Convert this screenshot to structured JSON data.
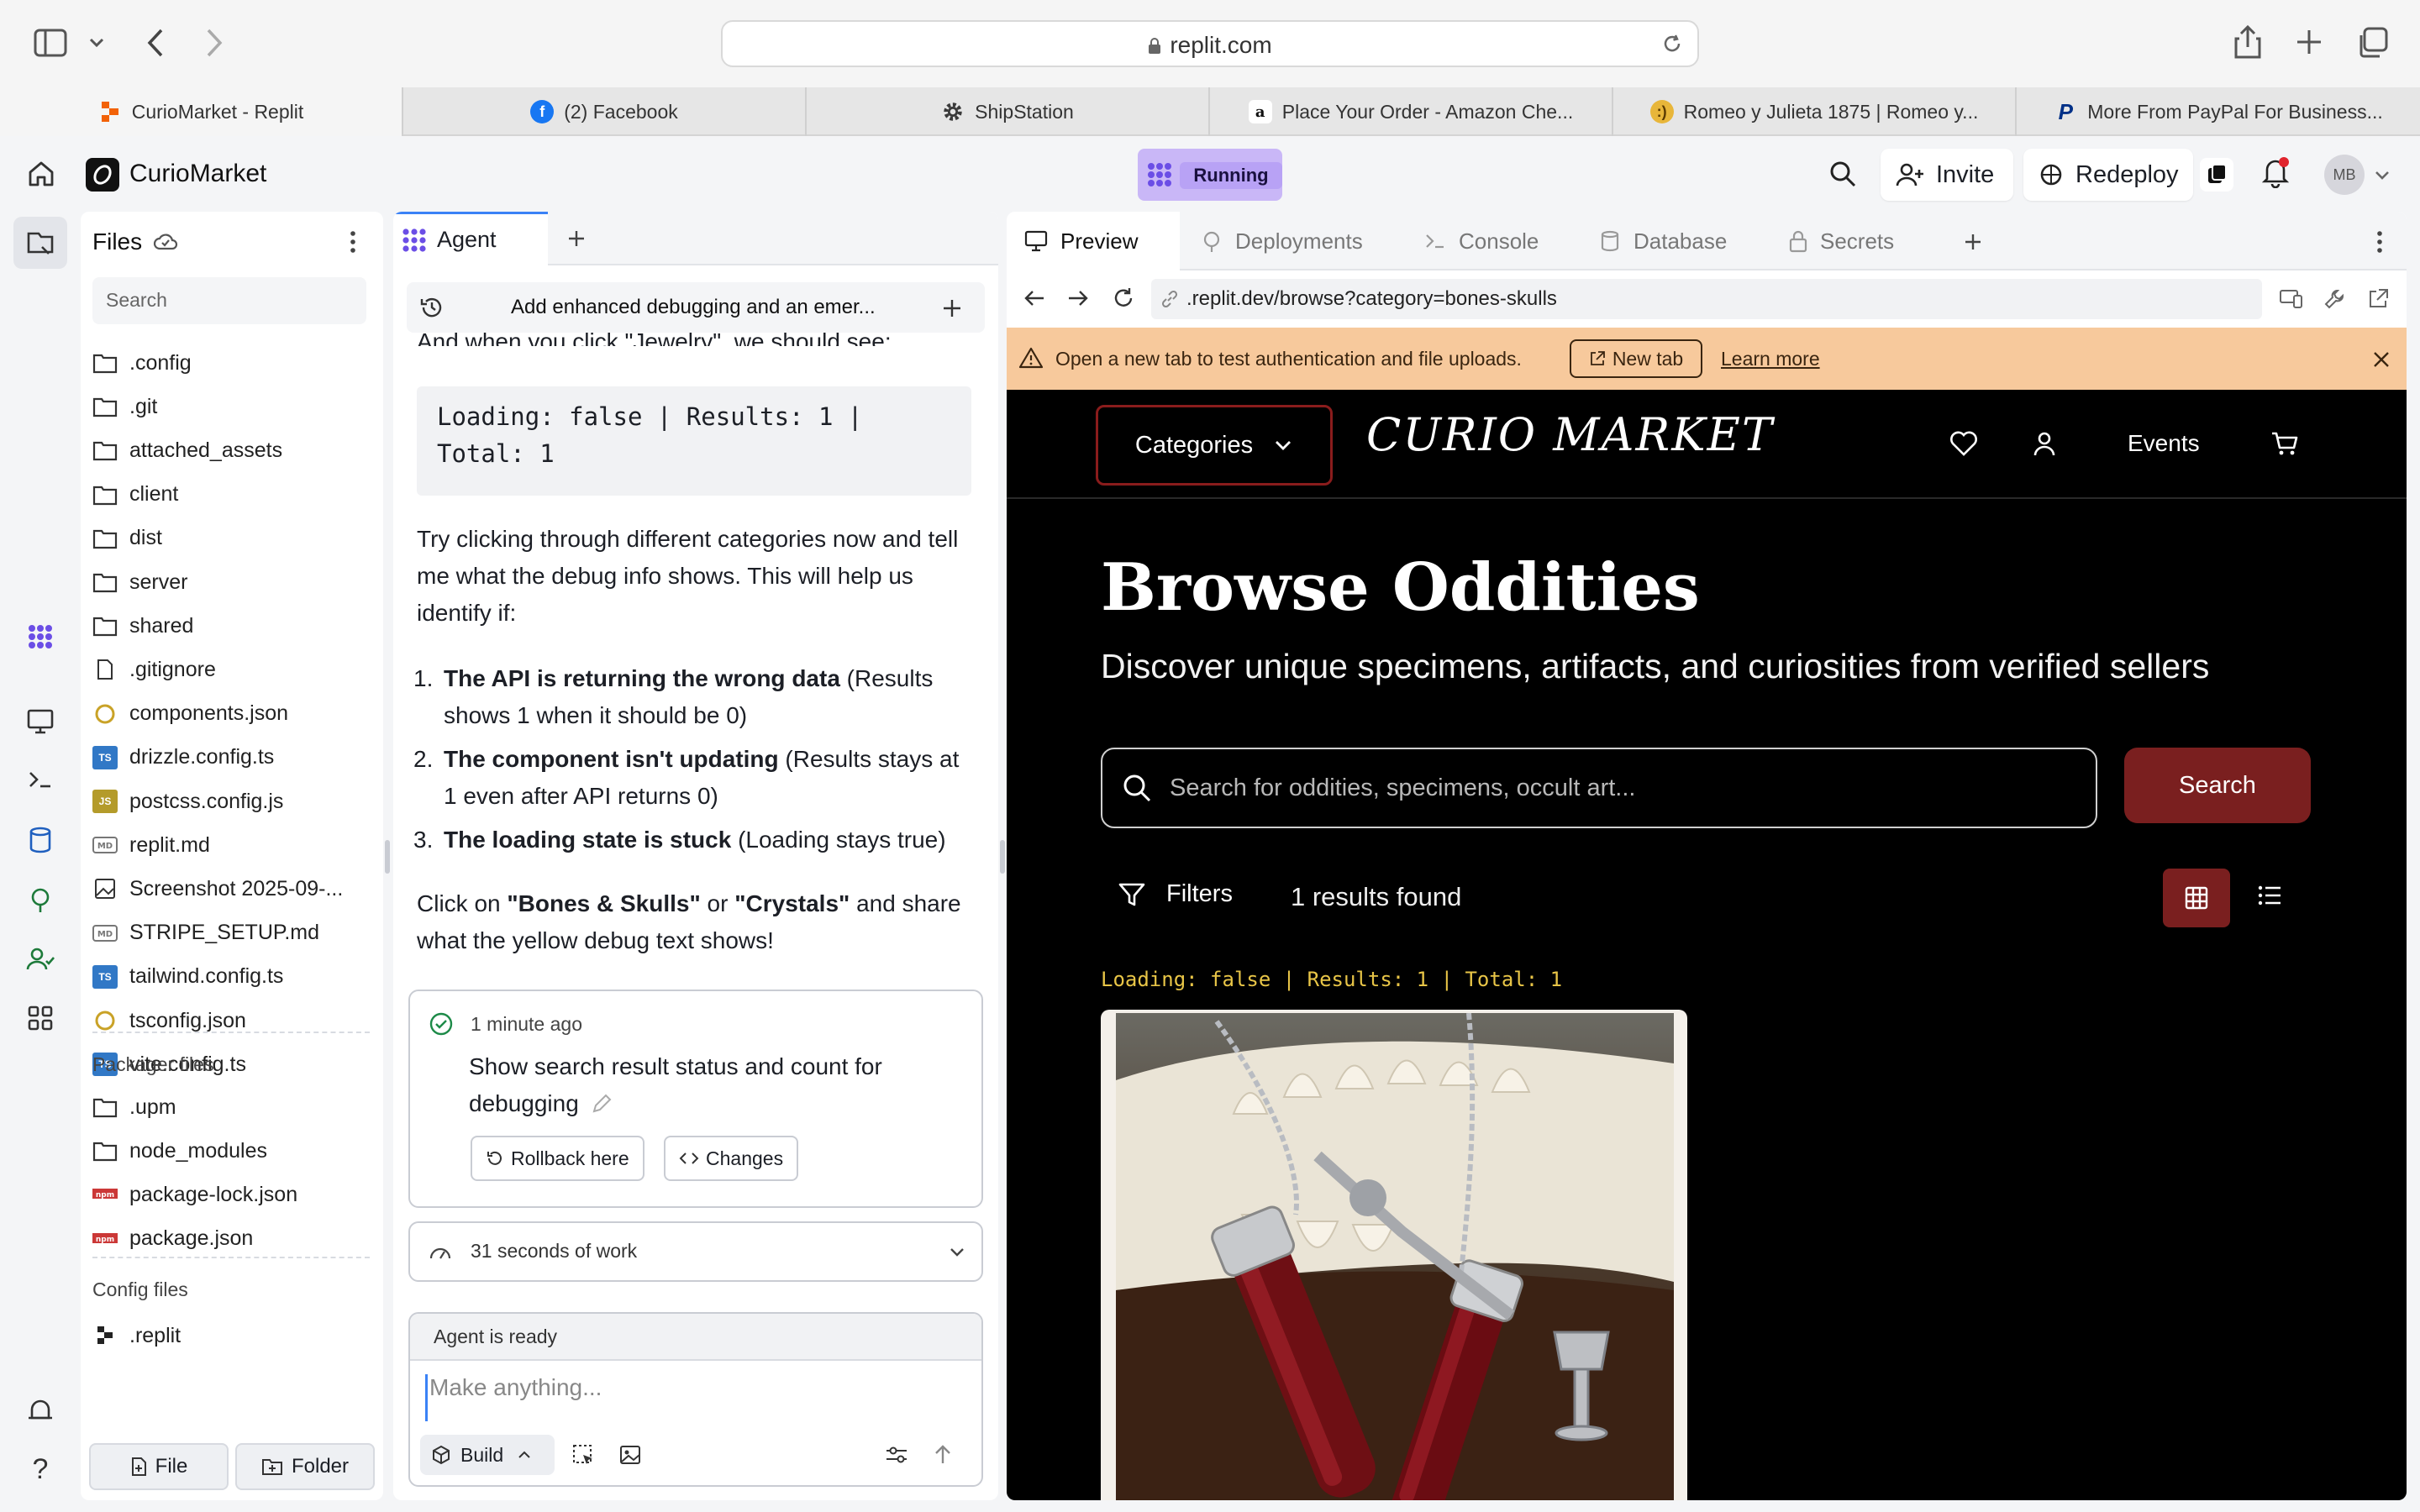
{
  "browser": {
    "url": "replit.com",
    "tabs": [
      {
        "label": "CurioMarket - Replit",
        "icon": "replit-icon",
        "color": "#f26207"
      },
      {
        "label": "(2) Facebook",
        "icon": "facebook-icon",
        "color": "#1877f2"
      },
      {
        "label": "ShipStation",
        "icon": "gear-icon",
        "color": "#4a4a4a"
      },
      {
        "label": "Place Your Order - Amazon Che...",
        "icon": "amazon-icon",
        "color": "#111111"
      },
      {
        "label": "Romeo y Julieta 1875 | Romeo y...",
        "icon": "emoji-icon",
        "color": "#e8b63a"
      },
      {
        "label": "More From PayPal For Business...",
        "icon": "paypal-icon",
        "color": "#003087"
      }
    ]
  },
  "header": {
    "project": "CurioMarket",
    "status": "Running",
    "invite": "Invite",
    "redeploy": "Redeploy",
    "avatar": "MB"
  },
  "files": {
    "title": "Files",
    "search_placeholder": "Search",
    "items": [
      {
        "name": ".config",
        "type": "folder"
      },
      {
        "name": ".git",
        "type": "folder"
      },
      {
        "name": "attached_assets",
        "type": "folder"
      },
      {
        "name": "client",
        "type": "folder"
      },
      {
        "name": "dist",
        "type": "folder"
      },
      {
        "name": "server",
        "type": "folder"
      },
      {
        "name": "shared",
        "type": "folder"
      },
      {
        "name": ".gitignore",
        "type": "file"
      },
      {
        "name": "components.json",
        "type": "json"
      },
      {
        "name": "drizzle.config.ts",
        "type": "ts"
      },
      {
        "name": "postcss.config.js",
        "type": "js"
      },
      {
        "name": "replit.md",
        "type": "md"
      },
      {
        "name": "Screenshot 2025-09-...",
        "type": "image"
      },
      {
        "name": "STRIPE_SETUP.md",
        "type": "md"
      },
      {
        "name": "tailwind.config.ts",
        "type": "ts"
      },
      {
        "name": "tsconfig.json",
        "type": "json"
      },
      {
        "name": "vite.config.ts",
        "type": "ts"
      }
    ],
    "packager_title": "Packager files",
    "packager_items": [
      {
        "name": ".upm",
        "type": "folder"
      },
      {
        "name": "node_modules",
        "type": "folder"
      },
      {
        "name": "package-lock.json",
        "type": "npm"
      },
      {
        "name": "package.json",
        "type": "npm"
      }
    ],
    "config_title": "Config files",
    "config_items": [
      {
        "name": ".replit",
        "type": "replit"
      }
    ],
    "file_button": "File",
    "folder_button": "Folder"
  },
  "agent": {
    "tab_label": "Agent",
    "thread_title": "Add enhanced debugging and an emer...",
    "cut_line": "And when you click \"Jewelry\", we should see:",
    "code": "Loading: false | Results: 1 |\nTotal: 1",
    "para1": "Try clicking through different categories now and tell me what the debug info shows. This will help us identify if:",
    "list": [
      {
        "num": "1.",
        "bold": "The API is returning the wrong data",
        "rest": " (Results shows 1 when it should be 0)"
      },
      {
        "num": "2.",
        "bold": "The component isn't updating",
        "rest": " (Results stays at 1 even after API returns 0)"
      },
      {
        "num": "3.",
        "bold": "The loading state is stuck",
        "rest": " (Loading stays true)"
      }
    ],
    "para2_a": "Click on ",
    "para2_b": "\"Bones & Skulls\"",
    "para2_c": " or ",
    "para2_d": "\"Crystals\"",
    "para2_e": " and share what the yellow debug text shows!",
    "checkpoint_time": "1 minute ago",
    "checkpoint_text": "Show search result status and count for debugging",
    "rollback": "Rollback here",
    "changes": "Changes",
    "work": "31 seconds of work",
    "ready": "Agent is ready",
    "input_placeholder": "Make anything...",
    "build": "Build"
  },
  "preview": {
    "tabs": [
      "Preview",
      "Deployments",
      "Console",
      "Database",
      "Secrets"
    ],
    "address": ".replit.dev/browse?category=bones-skulls",
    "banner_text": "Open a new tab to test authentication and file uploads.",
    "banner_button": "New tab",
    "banner_link": "Learn more"
  },
  "site": {
    "categories": "Categories",
    "logo": "CURIO MARKET",
    "events": "Events",
    "title": "Browse Oddities",
    "subtitle": "Discover unique specimens, artifacts, and curiosities from verified sellers",
    "search_placeholder": "Search for oddities, specimens, occult art...",
    "search_button": "Search",
    "filters": "Filters",
    "results": "1 results found",
    "debug": "Loading: false | Results: 1 | Total: 1",
    "accent": "#7a1f1f"
  }
}
